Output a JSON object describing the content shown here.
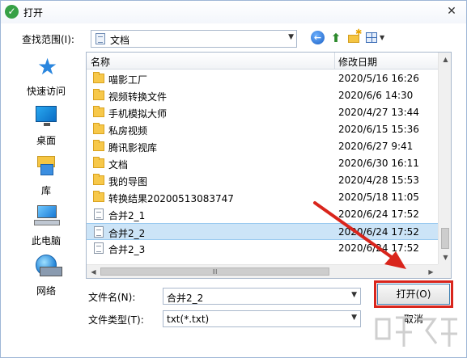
{
  "window": {
    "title": "打开",
    "close_glyph": "✕"
  },
  "look_in": {
    "label": "查找范围(I):",
    "value": "文档"
  },
  "places": [
    {
      "label": "快速访问",
      "icon": "star-icon"
    },
    {
      "label": "桌面",
      "icon": "desktop-icon"
    },
    {
      "label": "库",
      "icon": "library-icon"
    },
    {
      "label": "此电脑",
      "icon": "computer-icon"
    },
    {
      "label": "网络",
      "icon": "network-icon"
    }
  ],
  "file_list": {
    "columns": {
      "name": "名称",
      "date": "修改日期"
    },
    "rows": [
      {
        "name": "喵影工厂",
        "date": "2020/5/16 16:26",
        "type": "folder"
      },
      {
        "name": "视频转换文件",
        "date": "2020/6/6 14:30",
        "type": "folder"
      },
      {
        "name": "手机模拟大师",
        "date": "2020/4/27 13:44",
        "type": "folder"
      },
      {
        "name": "私房视频",
        "date": "2020/6/15 15:36",
        "type": "folder"
      },
      {
        "name": "腾讯影视库",
        "date": "2020/6/27 9:41",
        "type": "folder"
      },
      {
        "name": "文档",
        "date": "2020/6/30 16:11",
        "type": "folder"
      },
      {
        "name": "我的导图",
        "date": "2020/4/28 15:53",
        "type": "folder"
      },
      {
        "name": "转换结果20200513083747",
        "date": "2020/5/18 11:05",
        "type": "folder"
      },
      {
        "name": "合并2_1",
        "date": "2020/6/24 17:52",
        "type": "txt"
      },
      {
        "name": "合并2_2",
        "date": "2020/6/24 17:52",
        "type": "txt",
        "selected": true
      },
      {
        "name": "合并2_3",
        "date": "2020/6/24 17:52",
        "type": "txt"
      }
    ]
  },
  "filename": {
    "label": "文件名(N):",
    "value": "合并2_2"
  },
  "filetype": {
    "label": "文件类型(T):",
    "value": "txt(*.txt)"
  },
  "buttons": {
    "open": "打开(O)",
    "cancel": "取消"
  },
  "colors": {
    "highlight_red": "#d9251c",
    "selection": "#cce4f7"
  }
}
